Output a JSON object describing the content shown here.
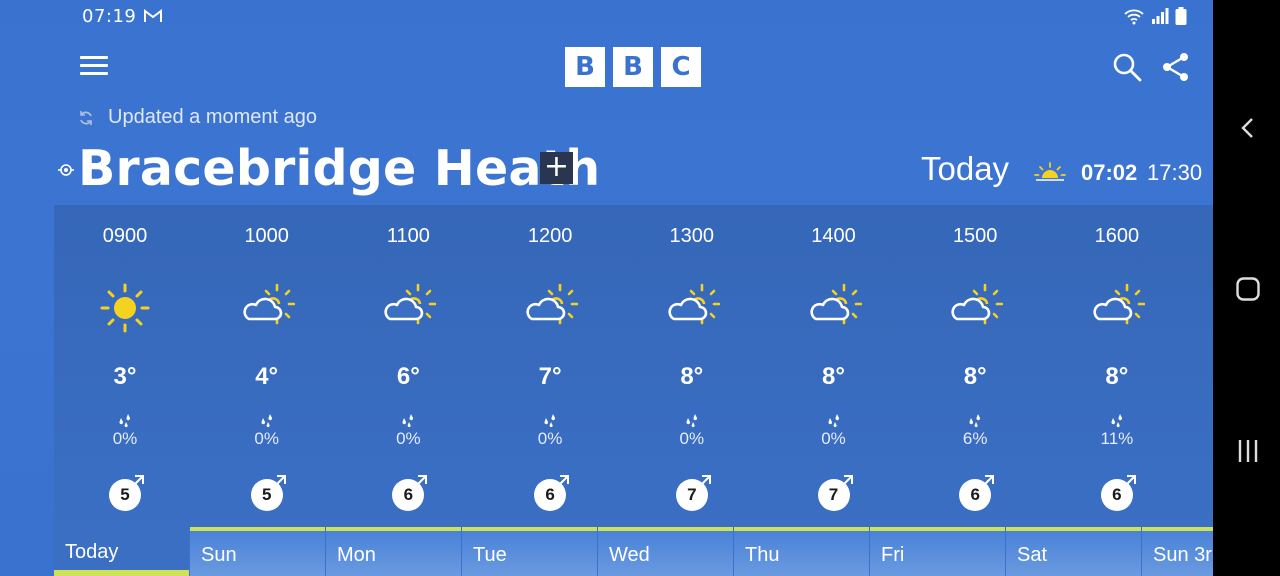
{
  "status_bar": {
    "time": "07:19"
  },
  "header": {
    "logo_letters": [
      "B",
      "B",
      "C"
    ]
  },
  "updated_text": "Updated a moment ago",
  "location": {
    "name": "Bracebridge Heath",
    "add_symbol": "+"
  },
  "today": {
    "label": "Today",
    "sunrise": "07:02",
    "sunset": "17:30"
  },
  "hourly": [
    {
      "time": "0900",
      "icon": "sunny-icon",
      "temp": "3°",
      "rain": "0%",
      "wind": "5"
    },
    {
      "time": "1000",
      "icon": "sunny-intervals-icon",
      "temp": "4°",
      "rain": "0%",
      "wind": "5"
    },
    {
      "time": "1100",
      "icon": "sunny-intervals-icon",
      "temp": "6°",
      "rain": "0%",
      "wind": "6"
    },
    {
      "time": "1200",
      "icon": "sunny-intervals-icon",
      "temp": "7°",
      "rain": "0%",
      "wind": "6"
    },
    {
      "time": "1300",
      "icon": "sunny-intervals-icon",
      "temp": "8°",
      "rain": "0%",
      "wind": "7"
    },
    {
      "time": "1400",
      "icon": "sunny-intervals-icon",
      "temp": "8°",
      "rain": "0%",
      "wind": "7"
    },
    {
      "time": "1500",
      "icon": "sunny-intervals-icon",
      "temp": "8°",
      "rain": "6%",
      "wind": "6"
    },
    {
      "time": "1600",
      "icon": "sunny-intervals-icon",
      "temp": "8°",
      "rain": "11%",
      "wind": "6"
    }
  ],
  "days": [
    {
      "label": "Today",
      "active": true
    },
    {
      "label": "Sun"
    },
    {
      "label": "Mon"
    },
    {
      "label": "Tue"
    },
    {
      "label": "Wed"
    },
    {
      "label": "Thu"
    },
    {
      "label": "Fri"
    },
    {
      "label": "Sat"
    },
    {
      "label": "Sun 3r"
    }
  ],
  "colors": {
    "background": "#3a72cf",
    "panel": "#3667b8",
    "accent_bar": "#cfe255",
    "sun": "#f5d21f"
  }
}
